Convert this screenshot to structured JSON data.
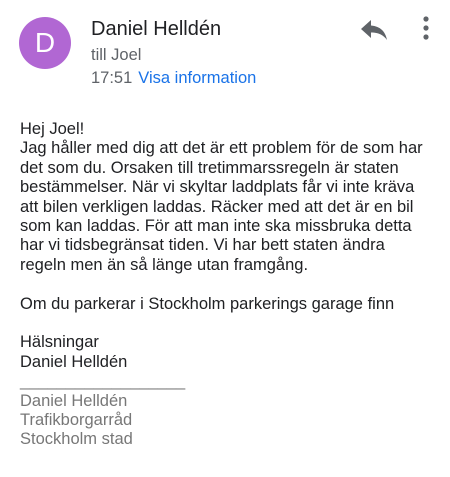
{
  "header": {
    "avatar_letter": "D",
    "avatar_color": "#b167d3",
    "sender_name": "Daniel Helldén",
    "recipient": "till Joel",
    "time": "17:51",
    "details_link": "Visa information",
    "reply_icon": "reply-icon",
    "more_icon": "more-vertical-icon"
  },
  "body": {
    "greeting": "Hej Joel!",
    "paragraph1": "Jag håller med dig att det är ett problem för de som har\ndet som du. Orsaken till tretimmarssregeln är staten\nbestämmelser. När vi skyltar laddplats får vi inte kräva\natt bilen verkligen laddas. Räcker med att det är en bil\nsom kan laddas. För att man inte ska missbruka detta\nhar vi tidsbegränsat tiden. Vi har bett staten ändra\nregeln men än så länge utan framgång.",
    "paragraph2": "Om du parkerar i Stockholm parkerings garage finn",
    "closing": "Hälsningar",
    "closing_name": "Daniel Helldén",
    "signature_rule": "__________________",
    "signature_name": "Daniel Helldén",
    "signature_title": "Trafikborgarråd",
    "signature_org": "Stockholm stad"
  }
}
